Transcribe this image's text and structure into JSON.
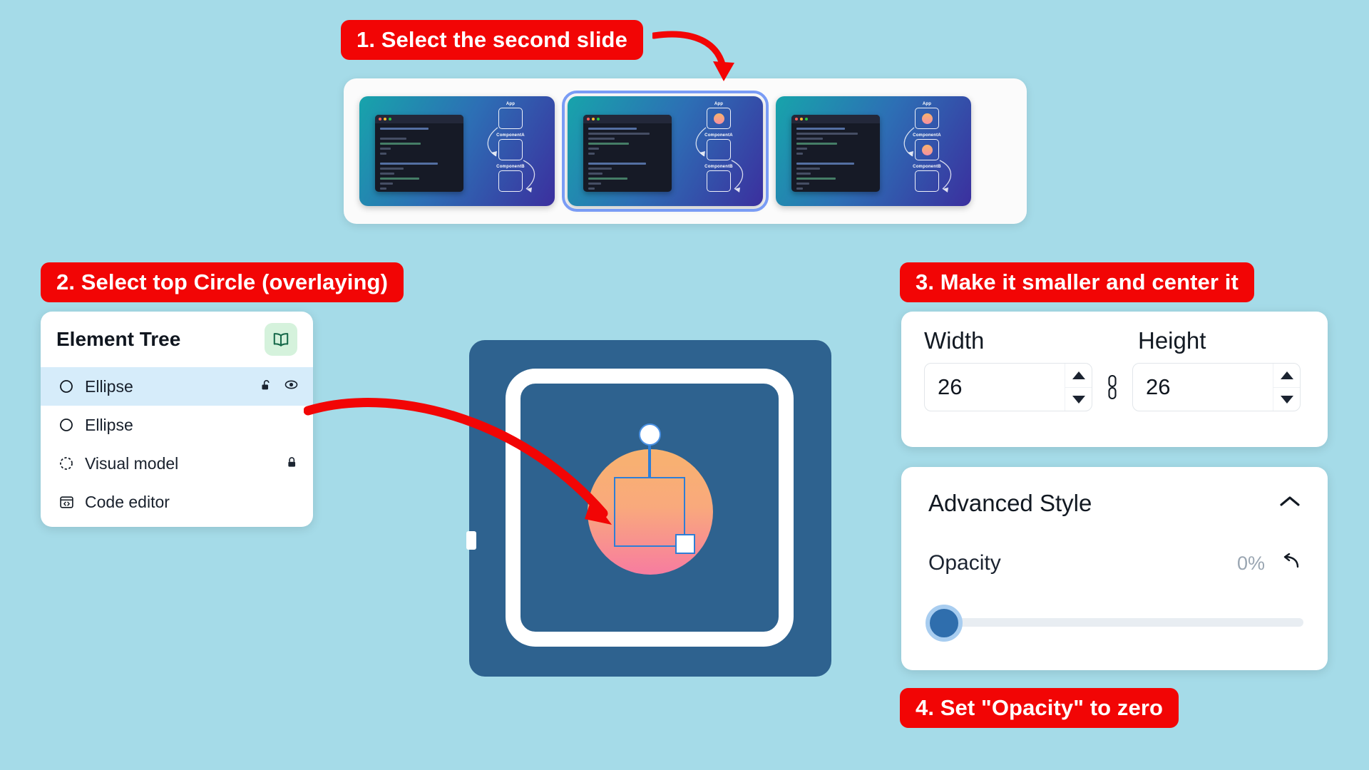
{
  "background_color": "#a5dbe8",
  "accent_color": "#f20505",
  "callouts": [
    {
      "id": 1,
      "text": "1. Select the second slide"
    },
    {
      "id": 2,
      "text": "2. Select top Circle (overlaying)"
    },
    {
      "id": 3,
      "text": "3. Make it smaller and center it"
    },
    {
      "id": 4,
      "text": "4. Set \"Opacity\" to zero"
    }
  ],
  "slide_strip": {
    "slides": [
      {
        "index": 1,
        "selected": false,
        "diagram": {
          "nodes": [
            {
              "label": "App",
              "has_circle": false
            },
            {
              "label": "ComponentA",
              "has_circle": false
            },
            {
              "label": "ComponentB",
              "has_circle": false
            }
          ]
        }
      },
      {
        "index": 2,
        "selected": true,
        "diagram": {
          "nodes": [
            {
              "label": "App",
              "has_circle": true
            },
            {
              "label": "ComponentA",
              "has_circle": false
            },
            {
              "label": "ComponentB",
              "has_circle": false
            }
          ]
        }
      },
      {
        "index": 3,
        "selected": false,
        "diagram": {
          "nodes": [
            {
              "label": "App",
              "has_circle": true
            },
            {
              "label": "ComponentA",
              "has_circle": true
            },
            {
              "label": "ComponentB",
              "has_circle": false
            }
          ]
        }
      }
    ]
  },
  "element_tree": {
    "title": "Element Tree",
    "header_icon": "open-book-icon",
    "items": [
      {
        "label": "Ellipse",
        "icon": "circle-outline-icon",
        "selected": true,
        "actions": [
          "unlock-icon",
          "eye-icon"
        ]
      },
      {
        "label": "Ellipse",
        "icon": "circle-outline-icon",
        "selected": false,
        "actions": []
      },
      {
        "label": "Visual model",
        "icon": "dashed-circle-outline-icon",
        "selected": false,
        "actions": [
          "lock-icon"
        ]
      },
      {
        "label": "Code editor",
        "icon": "code-window-icon",
        "selected": false,
        "actions": []
      }
    ]
  },
  "canvas": {
    "background_color": "#2e628f",
    "frame_color": "#ffffff",
    "shape": "circle",
    "shape_gradient_from": "#f8b26f",
    "shape_gradient_to": "#f77ca0",
    "selection_color": "#2e7ed6"
  },
  "size_panel": {
    "width_label": "Width",
    "height_label": "Height",
    "width_value": "26",
    "height_value": "26",
    "link_icon": "link-chain-icon",
    "aspect_linked": true
  },
  "advanced_style": {
    "title": "Advanced Style",
    "collapse_icon": "chevron-up-icon",
    "opacity_label": "Opacity",
    "opacity_value": "0%",
    "opacity_percent": 0,
    "reset_icon": "undo-arrow-icon",
    "slider_thumb_color": "#2f6ead",
    "slider_track_color": "#e8edf2"
  }
}
